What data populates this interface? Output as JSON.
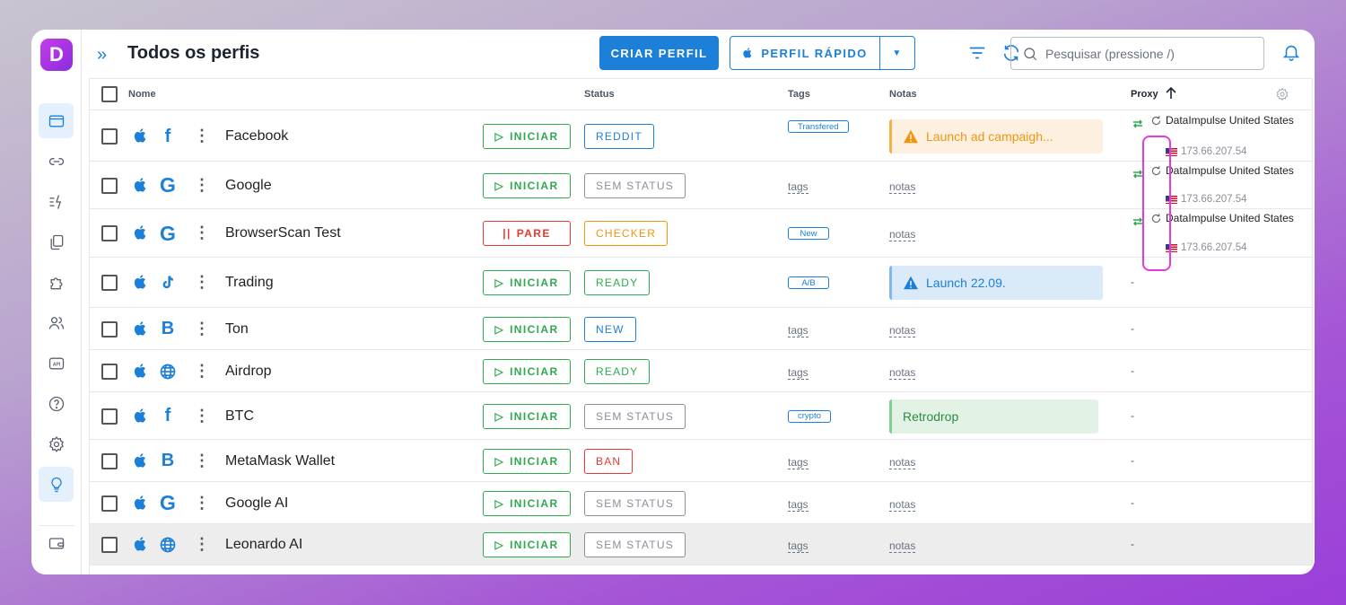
{
  "app": {
    "logo_letter": "D",
    "title": "Todos os perfis"
  },
  "toolbar": {
    "create_label": "CRIAR PERFIL",
    "quick_label": "PERFIL RÁPIDO",
    "search_placeholder": "Pesquisar (pressione /)"
  },
  "sidebar": {
    "items": [
      {
        "icon": "browser-icon",
        "active": true
      },
      {
        "icon": "link-icon",
        "active": false
      },
      {
        "icon": "automation-icon",
        "active": false
      },
      {
        "icon": "copy-icon",
        "active": false
      },
      {
        "icon": "puzzle-icon",
        "active": false
      },
      {
        "icon": "users-icon",
        "active": false
      },
      {
        "icon": "api-icon",
        "active": false
      },
      {
        "icon": "help-icon",
        "active": false
      },
      {
        "icon": "gear-icon",
        "active": false
      },
      {
        "icon": "lightbulb-icon",
        "active": true
      },
      {
        "icon": "wallet-icon",
        "active": false
      }
    ]
  },
  "table": {
    "headers": {
      "name": "Nome",
      "status": "Status",
      "tags": "Tags",
      "notes": "Notas",
      "proxy": "Proxy"
    },
    "placeholder_tags": "tags",
    "placeholder_notes": "notas",
    "rows": [
      {
        "name": "Facebook",
        "site": "f",
        "action": "INICIAR",
        "status": "REDDIT",
        "status_color": "#1c7fd8",
        "tag": "Transfered",
        "note": "Launch ad campaigh...",
        "note_type": "warn",
        "proxy": {
          "name": "DataImpulse United States",
          "ip": "173.66.207.54"
        }
      },
      {
        "name": "Google",
        "site": "G",
        "action": "INICIAR",
        "status": "SEM STATUS",
        "status_color": "#8a8f98",
        "tag": "",
        "note": "",
        "note_type": "",
        "proxy": {
          "name": "DataImpulse United States",
          "ip": "173.66.207.54"
        }
      },
      {
        "name": "BrowserScan Test",
        "site": "G",
        "action": "PARE",
        "status": "CHECKER",
        "status_color": "#f0960e",
        "tag": "New",
        "note": "",
        "note_type": "",
        "proxy": {
          "name": "DataImpulse United States",
          "ip": "173.66.207.54"
        }
      },
      {
        "name": "Trading",
        "site": "tiktok",
        "action": "INICIAR",
        "status": "READY",
        "status_color": "#2eaa4f",
        "tag": "A/B",
        "note": "Launch 22.09.",
        "note_type": "info",
        "proxy": null
      },
      {
        "name": "Ton",
        "site": "B",
        "action": "INICIAR",
        "status": "NEW",
        "status_color": "#1c7fd8",
        "tag": "",
        "note": "",
        "note_type": "",
        "proxy": null
      },
      {
        "name": "Airdrop",
        "site": "globe",
        "action": "INICIAR",
        "status": "READY",
        "status_color": "#2eaa4f",
        "tag": "",
        "note": "",
        "note_type": "",
        "proxy": null
      },
      {
        "name": "BTC",
        "site": "f",
        "action": "INICIAR",
        "status": "SEM STATUS",
        "status_color": "#8a8f98",
        "tag": "crypto",
        "note": "Retrodrop",
        "note_type": "succ",
        "proxy": null
      },
      {
        "name": "MetaMask Wallet",
        "site": "B",
        "action": "INICIAR",
        "status": "BAN",
        "status_color": "#e53935",
        "tag": "",
        "note": "",
        "note_type": "",
        "proxy": null
      },
      {
        "name": "Google AI",
        "site": "G",
        "action": "INICIAR",
        "status": "SEM STATUS",
        "status_color": "#8a8f98",
        "tag": "",
        "note": "",
        "note_type": "",
        "proxy": null
      },
      {
        "name": "Leonardo AI",
        "site": "globe",
        "action": "INICIAR",
        "status": "SEM STATUS",
        "status_color": "#8a8f98",
        "tag": "",
        "note": "",
        "note_type": "",
        "proxy": null
      }
    ],
    "empty_proxy": "-"
  }
}
